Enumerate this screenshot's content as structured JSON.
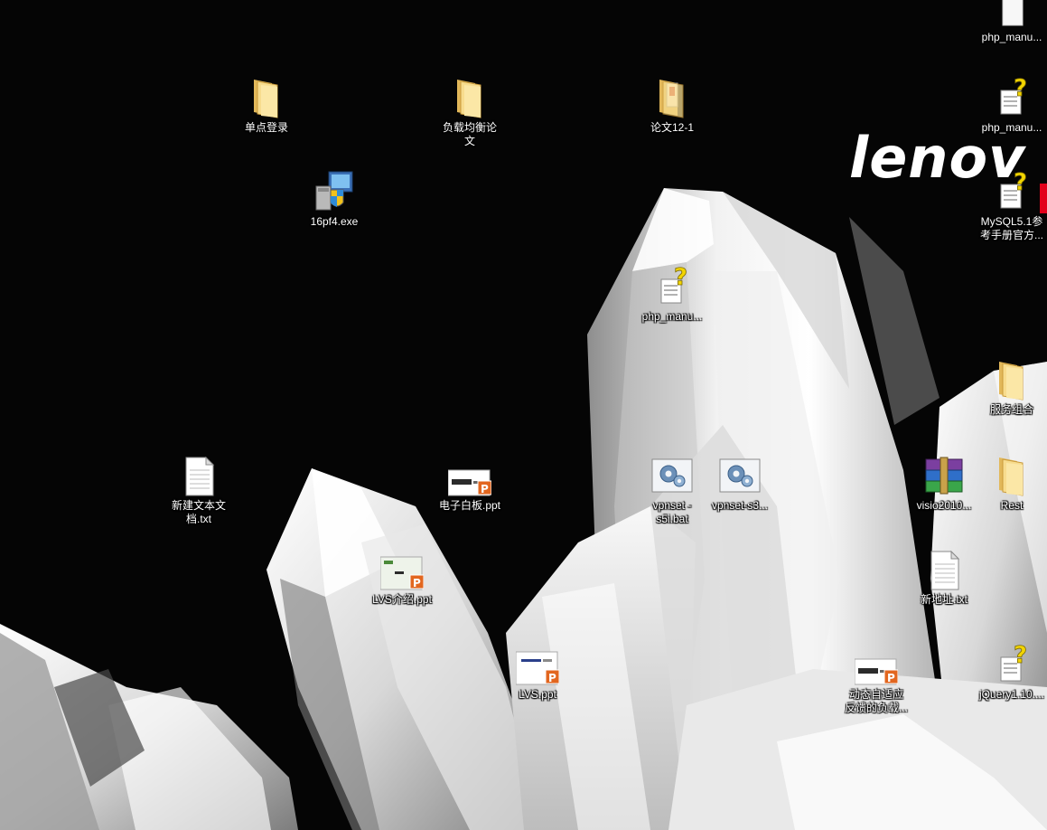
{
  "desktop": {
    "background_color": "#050505",
    "brand": {
      "logo_text": "lenov",
      "accent_color": "#e2001a"
    },
    "icons": [
      {
        "label": "php_manu...",
        "type": "document-page"
      },
      {
        "label": "单点登录",
        "type": "folder"
      },
      {
        "label": "负载均衡论\n文",
        "type": "folder"
      },
      {
        "label": "论文12-1",
        "type": "folder-document"
      },
      {
        "label": "php_manu...",
        "type": "help-file"
      },
      {
        "label": "MySQL5.1参\n考手册官方...",
        "type": "help-file"
      },
      {
        "label": "16pf4.exe",
        "type": "installer"
      },
      {
        "label": "php_manu...",
        "type": "help-file"
      },
      {
        "label": "服务组合",
        "type": "folder"
      },
      {
        "label": "新建文本文\n档.txt",
        "type": "text-file"
      },
      {
        "label": "电子白板.ppt",
        "type": "ppt-file"
      },
      {
        "label": "vpnset -\ns5i.bat",
        "type": "batch-file"
      },
      {
        "label": "vpnset-s3...",
        "type": "batch-file"
      },
      {
        "label": "visio2010...",
        "type": "rar-archive"
      },
      {
        "label": "Rest",
        "type": "folder"
      },
      {
        "label": "LVS介绍.ppt",
        "type": "ppt-file"
      },
      {
        "label": "新地址.txt",
        "type": "text-file"
      },
      {
        "label": "LVS.ppt",
        "type": "ppt-file"
      },
      {
        "label": "动态自适应\n反馈的负载...",
        "type": "ppt-file"
      },
      {
        "label": "jQuery1.10....",
        "type": "help-file"
      }
    ]
  }
}
